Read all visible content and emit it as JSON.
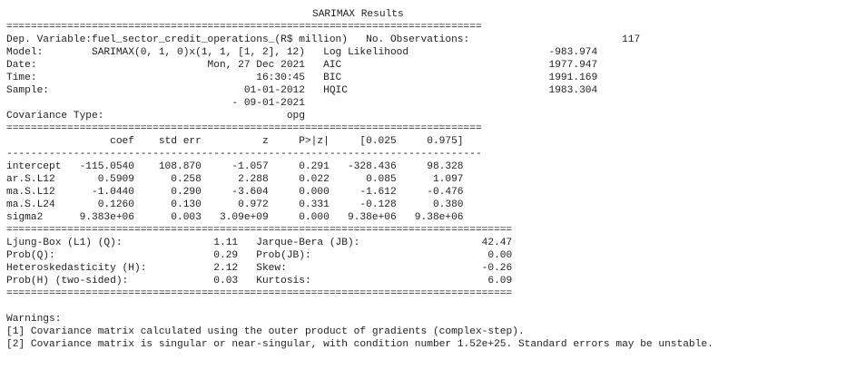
{
  "title": "SARIMAX Results",
  "rule_eq_wide": "==============================================================================",
  "rule_dash_wide": "------------------------------------------------------------------------------",
  "rule_eq_narrow": "===================================================================================",
  "top": {
    "dep_variable_label": "Dep. Variable:",
    "dep_variable_value": "fuel_sector_credit_operations_(R$ million)",
    "no_obs_label": "No. Observations:",
    "no_obs_value": "117",
    "model_label": "Model:",
    "model_value": "SARIMAX(0, 1, 0)x(1, 1, [1, 2], 12)",
    "log_likelihood_label": "Log Likelihood",
    "log_likelihood_value": "-983.974",
    "date_label": "Date:",
    "date_value": "Mon, 27 Dec 2021",
    "aic_label": "AIC",
    "aic_value": "1977.947",
    "time_label": "Time:",
    "time_value": "16:30:45",
    "bic_label": "BIC",
    "bic_value": "1991.169",
    "sample_label": "Sample:",
    "sample_value": "01-01-2012",
    "hqic_label": "HQIC",
    "hqic_value": "1983.304",
    "sample_end": "- 09-01-2021",
    "cov_type_label": "Covariance Type:",
    "cov_type_value": "opg"
  },
  "coef_table": {
    "headers": [
      "coef",
      "std err",
      "z",
      "P>|z|",
      "[0.025",
      "0.975]"
    ],
    "rows": [
      {
        "name": "intercept",
        "values": [
          "-115.0540",
          "108.870",
          "-1.057",
          "0.291",
          "-328.436",
          "98.328"
        ]
      },
      {
        "name": "ar.S.L12",
        "values": [
          "0.5909",
          "0.258",
          "2.288",
          "0.022",
          "0.085",
          "1.097"
        ]
      },
      {
        "name": "ma.S.L12",
        "values": [
          "-1.0440",
          "0.290",
          "-3.604",
          "0.000",
          "-1.612",
          "-0.476"
        ]
      },
      {
        "name": "ma.S.L24",
        "values": [
          "0.1260",
          "0.130",
          "0.972",
          "0.331",
          "-0.128",
          "0.380"
        ]
      },
      {
        "name": "sigma2",
        "values": [
          "9.383e+06",
          "0.003",
          "3.09e+09",
          "0.000",
          "9.38e+06",
          "9.38e+06"
        ]
      }
    ]
  },
  "diagnostics": [
    {
      "left_label": "Ljung-Box (L1) (Q):",
      "left_value": "1.11",
      "right_label": "Jarque-Bera (JB):",
      "right_value": "42.47"
    },
    {
      "left_label": "Prob(Q):",
      "left_value": "0.29",
      "right_label": "Prob(JB):",
      "right_value": "0.00"
    },
    {
      "left_label": "Heteroskedasticity (H):",
      "left_value": "2.12",
      "right_label": "Skew:",
      "right_value": "-0.26"
    },
    {
      "left_label": "Prob(H) (two-sided):",
      "left_value": "0.03",
      "right_label": "Kurtosis:",
      "right_value": "6.09"
    }
  ],
  "warnings": {
    "heading": "Warnings:",
    "items": [
      "[1] Covariance matrix calculated using the outer product of gradients (complex-step).",
      "[2] Covariance matrix is singular or near-singular, with condition number 1.52e+25. Standard errors may be unstable."
    ]
  }
}
